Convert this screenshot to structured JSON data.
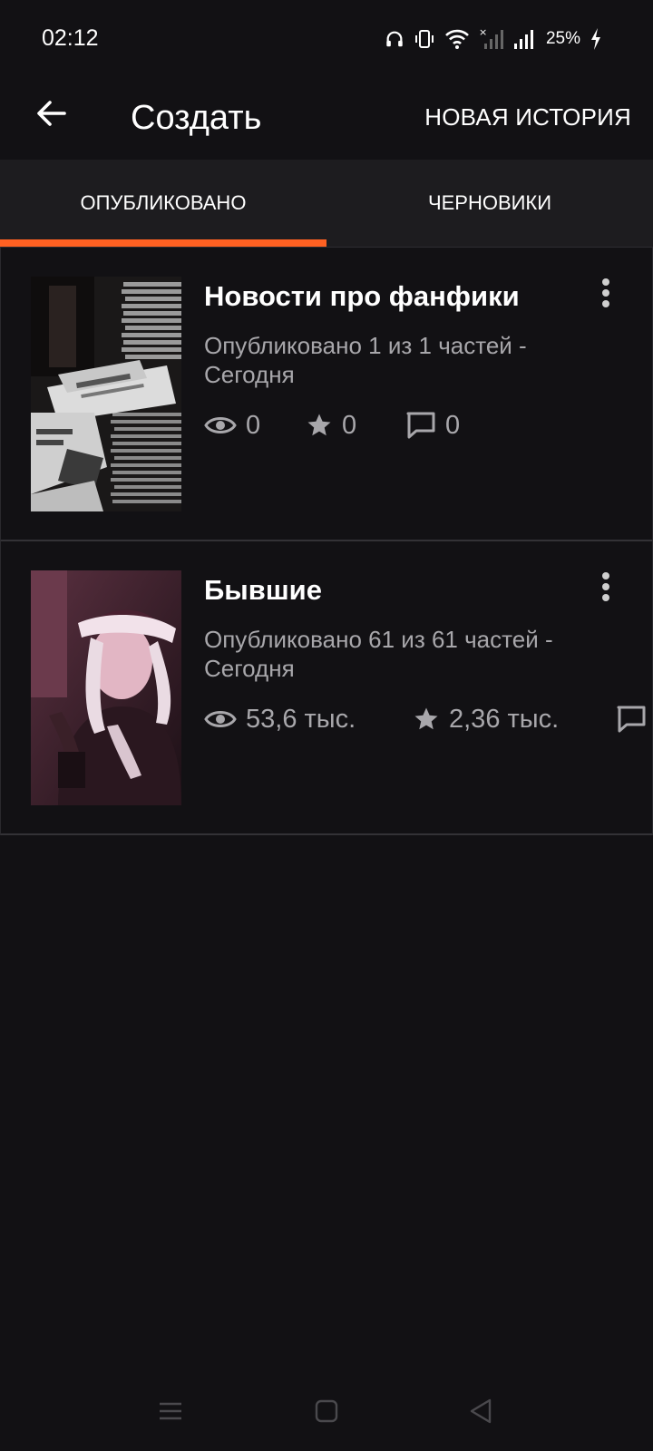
{
  "status_bar": {
    "time": "02:12",
    "battery": "25%",
    "icons": [
      "headphones-icon",
      "vibrate-icon",
      "wifi-icon",
      "no-signal-icon",
      "signal-icon",
      "battery-charging-icon"
    ]
  },
  "app_bar": {
    "title": "Создать",
    "new_story_label": "НОВАЯ ИСТОРИЯ",
    "back_icon": "arrow-back-icon"
  },
  "tabs": [
    {
      "label": "ОПУБЛИКОВАНО",
      "active": true
    },
    {
      "label": "ЧЕРНОВИКИ",
      "active": false
    }
  ],
  "colors": {
    "accent": "#ff6122",
    "background": "#121114",
    "tab_background": "#1d1c1f",
    "secondary_text": "#a8a7ab"
  },
  "stories": [
    {
      "title": "Новости про фанфики",
      "meta": "Опубликовано 1 из 1 частей - Сегодня",
      "views": "0",
      "votes": "0",
      "comments": "0",
      "cover": "newspapers-cover"
    },
    {
      "title": "Бывшие",
      "meta": "Опубликовано 61 из 61 частей - Сегодня",
      "views": "53,6 тыс.",
      "votes": "2,36 тыс.",
      "comments": "",
      "cover": "person-portrait-cover"
    }
  ],
  "nav_bar": {
    "icons": [
      "recent-apps-icon",
      "home-icon",
      "back-nav-icon"
    ]
  }
}
